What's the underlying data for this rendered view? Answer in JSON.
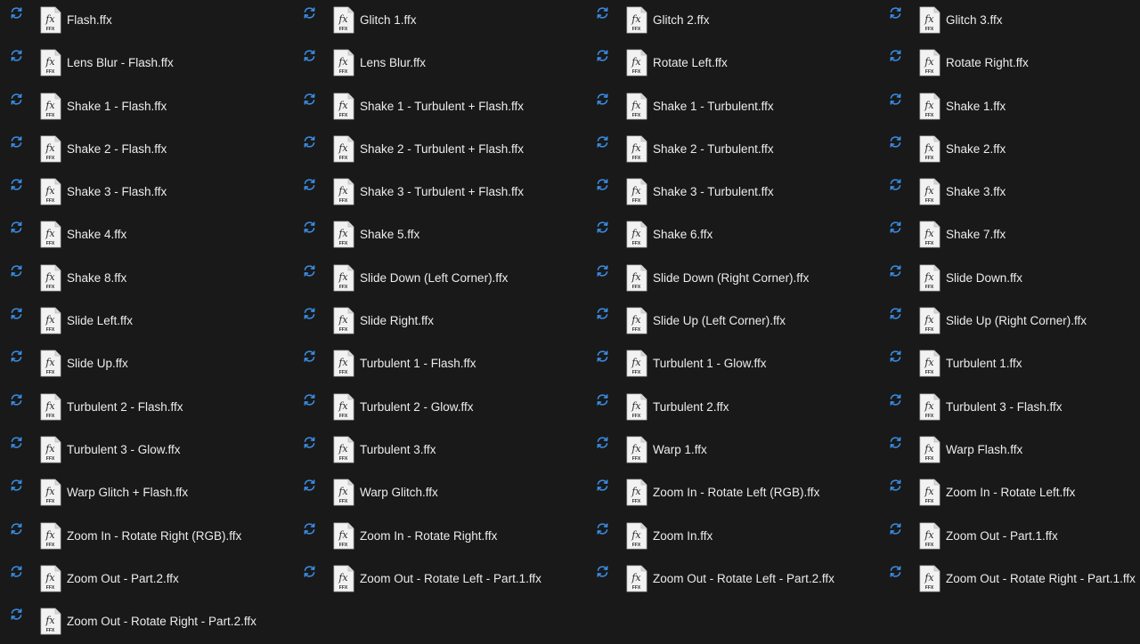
{
  "colors": {
    "background": "#191919",
    "sync_icon": "#3a8ee6",
    "file_icon_bg": "#f2f2f2",
    "file_icon_text": "#2a2a2a",
    "label_text": "#ececec"
  },
  "icons": {
    "status": "sync-pending-icon",
    "file": "ffx-file-icon",
    "file_glyph": "fx",
    "file_ext_label": "FFX"
  },
  "files": [
    {
      "name": "Flash.ffx"
    },
    {
      "name": "Glitch 1.ffx"
    },
    {
      "name": "Glitch 2.ffx"
    },
    {
      "name": "Glitch 3.ffx"
    },
    {
      "name": "Lens Blur - Flash.ffx"
    },
    {
      "name": "Lens Blur.ffx"
    },
    {
      "name": "Rotate Left.ffx"
    },
    {
      "name": "Rotate Right.ffx"
    },
    {
      "name": "Shake 1 - Flash.ffx"
    },
    {
      "name": "Shake 1 - Turbulent + Flash.ffx"
    },
    {
      "name": "Shake 1 - Turbulent.ffx"
    },
    {
      "name": "Shake 1.ffx"
    },
    {
      "name": "Shake 2 - Flash.ffx"
    },
    {
      "name": "Shake 2 - Turbulent + Flash.ffx"
    },
    {
      "name": "Shake 2 - Turbulent.ffx"
    },
    {
      "name": "Shake 2.ffx"
    },
    {
      "name": "Shake 3 - Flash.ffx"
    },
    {
      "name": "Shake 3 - Turbulent + Flash.ffx"
    },
    {
      "name": "Shake 3 - Turbulent.ffx"
    },
    {
      "name": "Shake 3.ffx"
    },
    {
      "name": "Shake 4.ffx"
    },
    {
      "name": "Shake 5.ffx"
    },
    {
      "name": "Shake 6.ffx"
    },
    {
      "name": "Shake 7.ffx"
    },
    {
      "name": "Shake 8.ffx"
    },
    {
      "name": "Slide Down (Left Corner).ffx"
    },
    {
      "name": "Slide Down (Right Corner).ffx"
    },
    {
      "name": "Slide Down.ffx"
    },
    {
      "name": "Slide Left.ffx"
    },
    {
      "name": "Slide Right.ffx"
    },
    {
      "name": "Slide Up (Left Corner).ffx"
    },
    {
      "name": "Slide Up (Right Corner).ffx"
    },
    {
      "name": "Slide Up.ffx"
    },
    {
      "name": "Turbulent 1 - Flash.ffx"
    },
    {
      "name": "Turbulent 1 - Glow.ffx"
    },
    {
      "name": "Turbulent 1.ffx"
    },
    {
      "name": "Turbulent 2 - Flash.ffx"
    },
    {
      "name": "Turbulent 2 - Glow.ffx"
    },
    {
      "name": "Turbulent 2.ffx"
    },
    {
      "name": "Turbulent 3 - Flash.ffx"
    },
    {
      "name": "Turbulent 3 - Glow.ffx"
    },
    {
      "name": "Turbulent 3.ffx"
    },
    {
      "name": "Warp 1.ffx"
    },
    {
      "name": "Warp Flash.ffx"
    },
    {
      "name": "Warp Glitch + Flash.ffx"
    },
    {
      "name": "Warp Glitch.ffx"
    },
    {
      "name": "Zoom In - Rotate Left (RGB).ffx"
    },
    {
      "name": "Zoom In - Rotate Left.ffx"
    },
    {
      "name": "Zoom In - Rotate Right (RGB).ffx"
    },
    {
      "name": "Zoom In - Rotate Right.ffx"
    },
    {
      "name": "Zoom In.ffx"
    },
    {
      "name": "Zoom Out - Part.1.ffx"
    },
    {
      "name": "Zoom Out - Part.2.ffx"
    },
    {
      "name": "Zoom Out - Rotate Left - Part.1.ffx"
    },
    {
      "name": "Zoom Out - Rotate Left - Part.2.ffx"
    },
    {
      "name": "Zoom Out - Rotate Right - Part.1.ffx"
    },
    {
      "name": "Zoom Out - Rotate Right - Part.2.ffx"
    }
  ]
}
